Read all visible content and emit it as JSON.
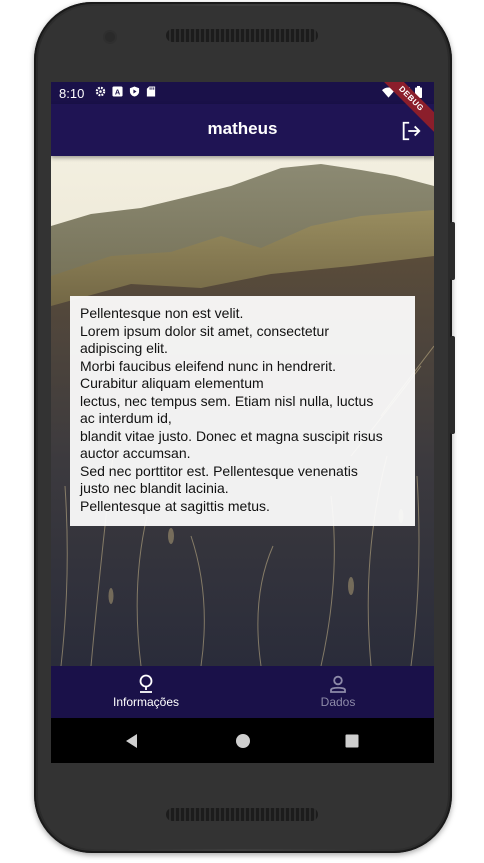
{
  "status_bar": {
    "time": "8:10",
    "left_icons": [
      "settings-icon",
      "a-box-icon",
      "shield-play-icon",
      "sd-card-icon"
    ],
    "right_icons": [
      "wifi-icon",
      "signal-icon",
      "battery-icon"
    ],
    "debug_banner": "DEBUG"
  },
  "app_bar": {
    "title": "matheus",
    "action_icon": "logout-icon"
  },
  "card": {
    "lines": [
      "Pellentesque non est velit.",
      "Lorem ipsum dolor sit amet, consectetur",
      "adipiscing elit.",
      "Morbi faucibus eleifend nunc in hendrerit.",
      "Curabitur aliquam elementum",
      "lectus, nec tempus sem. Etiam nisl nulla, luctus",
      "ac interdum id,",
      "blandit vitae justo. Donec et magna suscipit risus",
      "auctor accumsan.",
      "Sed nec porttitor est. Pellentesque venenatis",
      "justo nec blandit lacinia.",
      "Pellentesque at sagittis metus."
    ]
  },
  "bottom_nav": {
    "items": [
      {
        "label": "Informações",
        "icon": "map-pin-icon",
        "active": true
      },
      {
        "label": "Dados",
        "icon": "person-icon",
        "active": false
      }
    ]
  },
  "system_nav": {
    "icons": [
      "back-icon",
      "home-icon",
      "recents-icon"
    ]
  },
  "colors": {
    "app_bar": "#1f1454",
    "status_bar": "#1a1149",
    "nav_active": "#ffffff",
    "nav_inactive": "#8d8aa8"
  }
}
